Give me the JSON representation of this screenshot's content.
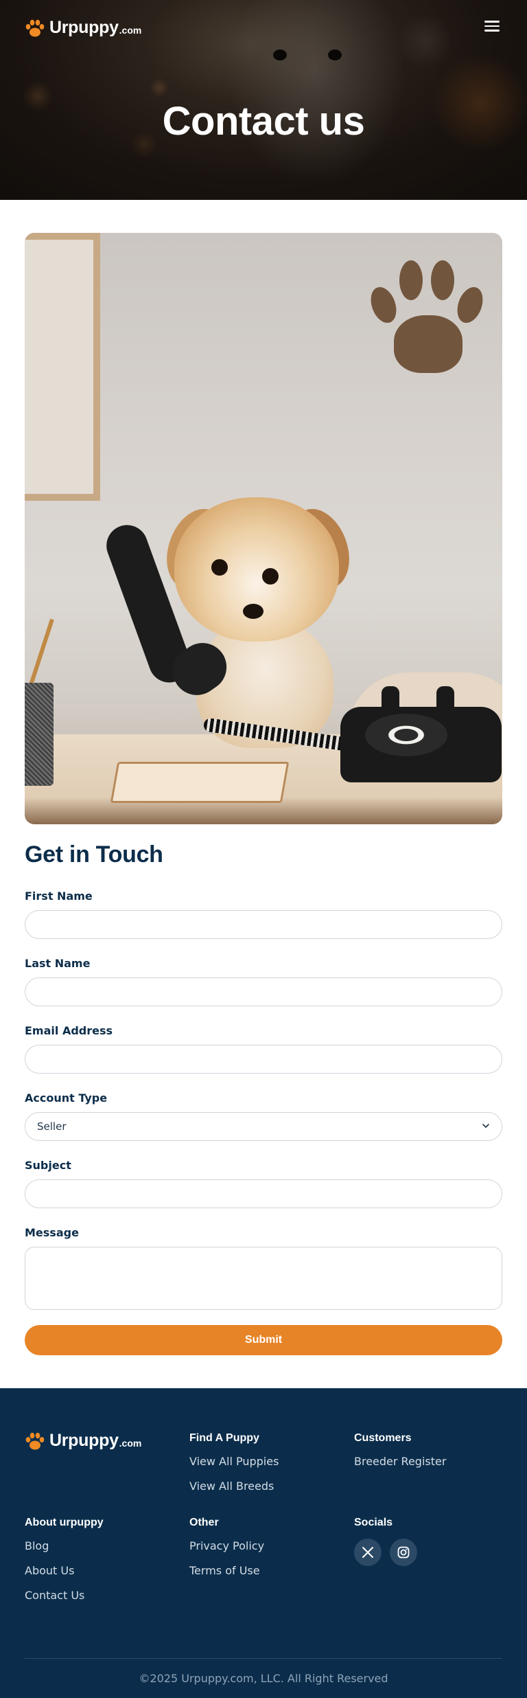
{
  "header": {
    "logo_text": "Urpuppy",
    "logo_tld": ".com",
    "menu_icon": "hamburger-icon",
    "title": "Contact us"
  },
  "form": {
    "title": "Get in Touch",
    "fields": {
      "first_name": {
        "label": "First Name",
        "value": ""
      },
      "last_name": {
        "label": "Last Name",
        "value": ""
      },
      "email": {
        "label": "Email Address",
        "value": ""
      },
      "account_type": {
        "label": "Account Type",
        "value": "Seller"
      },
      "subject": {
        "label": "Subject",
        "value": ""
      },
      "message": {
        "label": "Message",
        "value": ""
      }
    },
    "submit_label": "Submit"
  },
  "footer": {
    "logo_text": "Urpuppy",
    "logo_tld": ".com",
    "find_a_puppy": {
      "title": "Find A Puppy",
      "links": [
        "View All Puppies",
        "View All Breeds"
      ]
    },
    "customers": {
      "title": "Customers",
      "links": [
        "Breeder Register"
      ]
    },
    "about": {
      "title": "About urpuppy",
      "links": [
        "Blog",
        "About Us",
        "Contact Us"
      ]
    },
    "other": {
      "title": "Other",
      "links": [
        "Privacy Policy",
        "Terms of Use"
      ]
    },
    "socials": {
      "title": "Socials",
      "icons": [
        "x-icon",
        "instagram-icon"
      ]
    },
    "copyright": "©2025 Urpuppy.com, LLC. All Right Reserved"
  },
  "colors": {
    "navy": "#0c2d4a",
    "accent": "#e78427",
    "footer_bg": "#0b2d4b"
  }
}
